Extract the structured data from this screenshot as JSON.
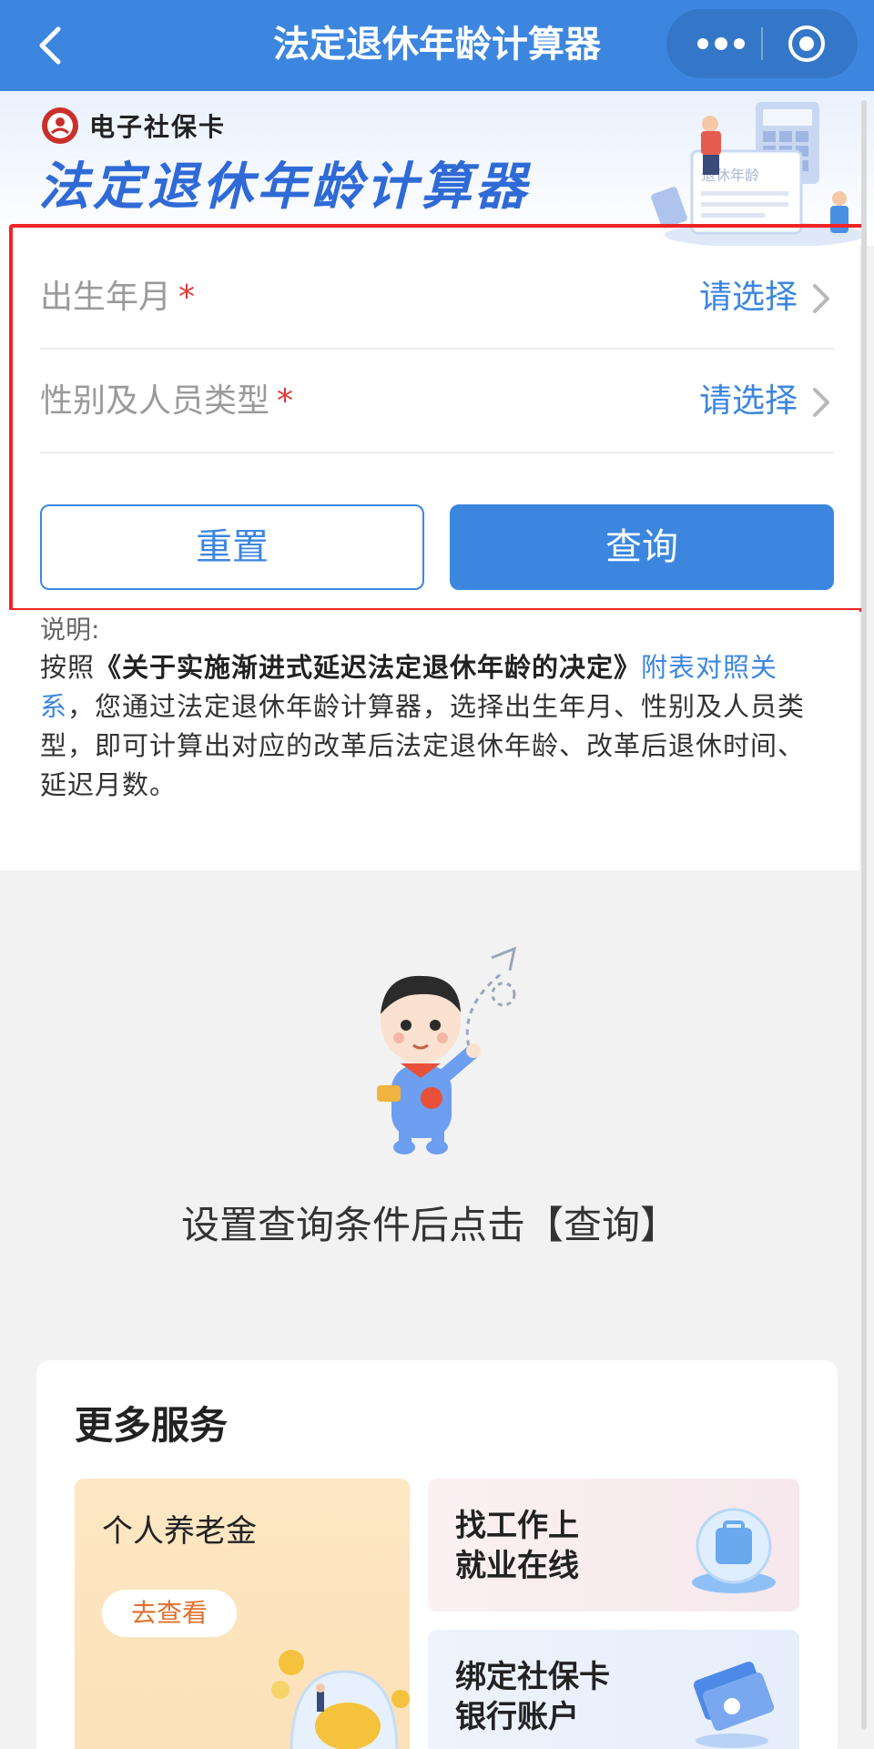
{
  "navbar": {
    "title": "法定退休年龄计算器",
    "back_icon": "chevron-left-icon",
    "more_icon": "more-dots-icon",
    "target_icon": "target-icon"
  },
  "banner": {
    "brand": "电子社保卡",
    "title": "法定退休年龄计算器",
    "illustration_caption": "退休年龄"
  },
  "form": {
    "birth": {
      "label": "出生年月",
      "required_mark": "*",
      "value": "请选择"
    },
    "gender": {
      "label": "性别及人员类型",
      "required_mark": "*",
      "value": "请选择"
    },
    "reset_label": "重置",
    "query_label": "查询"
  },
  "note": {
    "heading": "说明:",
    "prefix": "按照",
    "doc_title": "《关于实施渐进式延迟法定退休年龄的决定》",
    "link_text": "附表对照关系",
    "body": "，您通过法定退休年龄计算器，选择出生年月、性别及人员类型，即可计算出对应的改革后法定退休年龄、改革后退休时间、延迟月数。"
  },
  "empty_state": {
    "text": "设置查询条件后点击【查询】"
  },
  "services": {
    "title": "更多服务",
    "pension": {
      "title": "个人养老金",
      "button": "去查看"
    },
    "job": {
      "line1": "找工作上",
      "line2": "就业在线"
    },
    "bank": {
      "line1": "绑定社保卡",
      "line2": "银行账户"
    }
  },
  "colors": {
    "primary": "#3c86e0",
    "required": "#e23838",
    "highlight_frame": "#ef2323",
    "pension_accent": "#e0702e"
  }
}
